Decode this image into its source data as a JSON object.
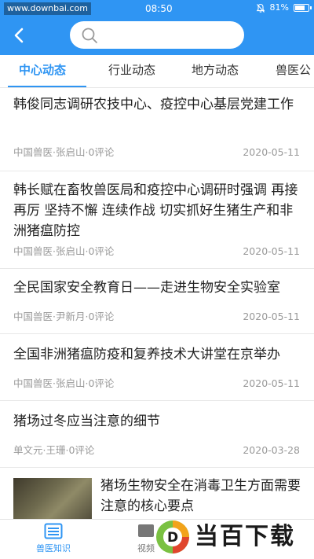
{
  "status_bar": {
    "site": "www.downbai.com",
    "time": "08:50",
    "battery": "81%",
    "battery_level": 0.81
  },
  "search": {
    "value": "",
    "placeholder": ""
  },
  "tabs": [
    {
      "label": "中心动态",
      "active": true
    },
    {
      "label": "行业动态",
      "active": false
    },
    {
      "label": "地方动态",
      "active": false
    },
    {
      "label": "兽医公",
      "active": false
    }
  ],
  "articles": [
    {
      "title": "韩俊同志调研农技中心、疫控中心基层党建工作",
      "meta": "中国兽医·张启山·0评论",
      "date": "2020-05-11"
    },
    {
      "title": "韩长赋在畜牧兽医局和疫控中心调研时强调 再接再厉 坚持不懈 连续作战 切实抓好生猪生产和非洲猪瘟防控",
      "meta": "中国兽医·张启山·0评论",
      "date": "2020-05-11"
    },
    {
      "title": "全民国家安全教育日——走进生物安全实验室",
      "meta": "中国兽医·尹新月·0评论",
      "date": "2020-05-11"
    },
    {
      "title": "全国非洲猪瘟防疫和复养技术大讲堂在京举办",
      "meta": "中国兽医·张启山·0评论",
      "date": "2020-05-11"
    },
    {
      "title": "猪场过冬应当注意的细节",
      "meta": "单文元·王珊·0评论",
      "date": "2020-03-28"
    },
    {
      "title": "猪场生物安全在消毒卫生方面需要注意的核心要点",
      "thumbnail": true
    }
  ],
  "bottom_nav": [
    {
      "label": "兽医知识",
      "icon": "list-icon",
      "active": true
    },
    {
      "label": "视频",
      "icon": "video-icon",
      "active": false
    }
  ],
  "watermark": {
    "text": "当百下载",
    "logo_letter": "D"
  },
  "colors": {
    "accent": "#2f95f3",
    "meta_text": "#999999"
  }
}
